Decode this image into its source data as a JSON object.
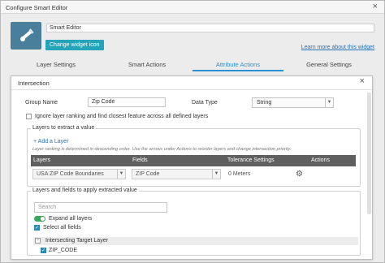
{
  "window": {
    "title": "Configure Smart Editor",
    "close": "×"
  },
  "widget": {
    "name": "Smart Editor",
    "change_icon": "Change widget icon",
    "learn_more": "Learn more about this widget",
    "icon": "wrench-pencil-icon"
  },
  "tabs": [
    {
      "label": "Layer Settings"
    },
    {
      "label": "Smart Actions"
    },
    {
      "label": "Attribute Actions",
      "active": true
    },
    {
      "label": "General Settings"
    }
  ],
  "dialog": {
    "title": "Intersection",
    "close": "×",
    "group_name_label": "Group Name",
    "group_name_value": "Zip Code",
    "data_type_label": "Data Type",
    "data_type_value": "String",
    "ignore_ranking_label": "Ignore layer ranking and find closest feature across all defined layers",
    "layers_section": {
      "legend": "Layers to extract a value",
      "add_layer": "Add a Layer",
      "hint": "Layer ranking is determined in descending order. Use the arrows under Actions to reorder layers and change intersection priority.",
      "columns": [
        "Layers",
        "Fields",
        "Tolerance Settings",
        "Actions"
      ],
      "rows": [
        {
          "layer": "USA ZIP Code Boundaries",
          "field": "ZIP Code",
          "tolerance": "0 Meters"
        }
      ]
    },
    "fields_section": {
      "legend": "Layers and fields to apply extracted value",
      "search_placeholder": "Search",
      "expand_all": "Expand all layers",
      "select_all": "Select all fields",
      "group_label": "Intersecting Target Layer",
      "field_label": "ZIP_CODE"
    }
  },
  "colors": {
    "accent": "#2b8fd1",
    "button": "#24a4b8",
    "table_header": "#5f5f5f",
    "toggle_on": "#3aa55d"
  }
}
